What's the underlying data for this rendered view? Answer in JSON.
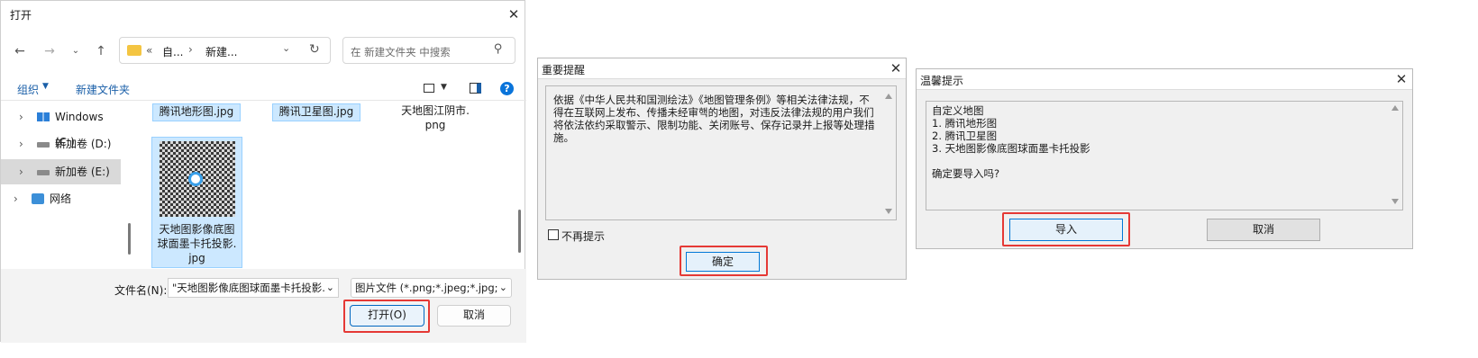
{
  "open_dialog": {
    "title": "打开",
    "address": {
      "crumb1": "自...",
      "crumb2": "新建...",
      "sep": "«"
    },
    "search_placeholder": "在 新建文件夹 中搜索",
    "toolbar": {
      "organize": "组织",
      "new_folder": "新建文件夹"
    },
    "tree": [
      {
        "label": "Windows (C:)",
        "icon": "windows-drive-icon"
      },
      {
        "label": "新加卷 (D:)",
        "icon": "drive-icon"
      },
      {
        "label": "新加卷 (E:)",
        "icon": "drive-icon",
        "selected": true
      },
      {
        "label": "网络",
        "icon": "network-icon"
      }
    ],
    "files": {
      "f1": "腾讯地形图.jpg",
      "f2": "腾讯卫星图.jpg",
      "f3a": "天地图江阴市.",
      "f3b": "png",
      "f4a": "天地图影像底图",
      "f4b": "球面墨卡托投影.",
      "f4c": "jpg"
    },
    "filename_label": "文件名(N):",
    "filename_value": "\"天地图影像底图球面墨卡托投影.",
    "filetype_value": "图片文件 (*.png;*.jpeg;*.jpg;*.",
    "open_button": "打开(O)",
    "cancel_button": "取消"
  },
  "notice_dialog": {
    "title": "重要提醒",
    "body": "依据《中华人民共和国测绘法》《地图管理条例》等相关法律法规，不得在互联网上发布、传播未经审핵的地图，对违反法律法规的用户我们将依法依约采取警示、限制功能、关闭账号、保存记录并上报等处理措施。",
    "checkbox_label": "不再提示",
    "ok_button": "确定"
  },
  "import_dialog": {
    "title": "温馨提示",
    "lines": [
      "自定义地图",
      "1. 腾讯地形图",
      "2. 腾讯卫星图",
      "3. 天地图影像底图球面墨卡托投影"
    ],
    "question": "确定要导入吗?",
    "import_button": "导入",
    "cancel_button": "取消"
  },
  "colors": {
    "accent": "#0067c0",
    "highlight": "#e53935",
    "selection": "#cce8ff"
  }
}
